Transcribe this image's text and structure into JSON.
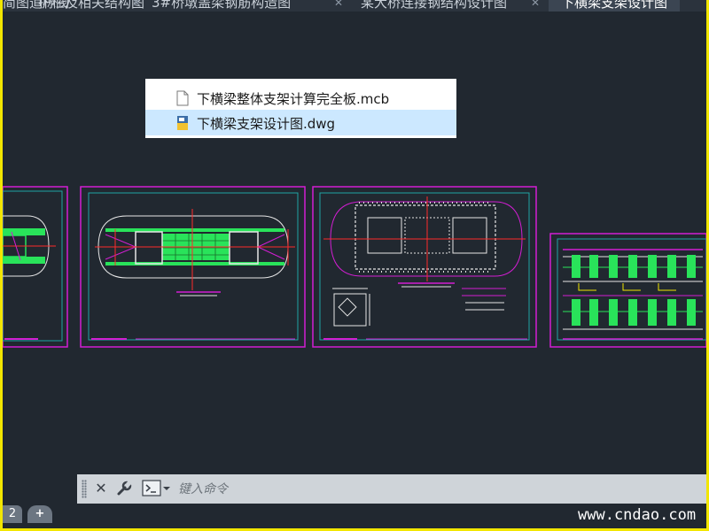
{
  "tabs": [
    {
      "label": "护栏及相关结构图"
    },
    {
      "label": "3#桥墩盖梁钢筋构造图"
    },
    {
      "label": "某大桥连接钢结构设计图"
    },
    {
      "label": "下横梁支架设计图"
    }
  ],
  "active_tab_index": 3,
  "left_partial_label": "简图道标阀",
  "file_list": [
    {
      "name": "下横梁整体支架计算完全板.mcb",
      "icon": "document-icon",
      "selected": false
    },
    {
      "name": "下横梁支架设计图.dwg",
      "icon": "dwg-file-icon",
      "selected": true
    }
  ],
  "command_line": {
    "close_icon": "close-icon",
    "settings_icon": "wrench-icon",
    "prompt_icon": "command-prompt-icon",
    "placeholder": "键入命令"
  },
  "layout_tabs": [
    {
      "label": "2"
    },
    {
      "label": "+"
    }
  ],
  "watermark": "www.cndao.com",
  "colors": {
    "background": "#212830",
    "frame_magenta": "#d21ed2",
    "green": "#29e35a",
    "red": "#ff2a2a",
    "white_lines": "#e6e6e6",
    "border_yellow": "#f2e600",
    "selection": "#cce8ff"
  }
}
